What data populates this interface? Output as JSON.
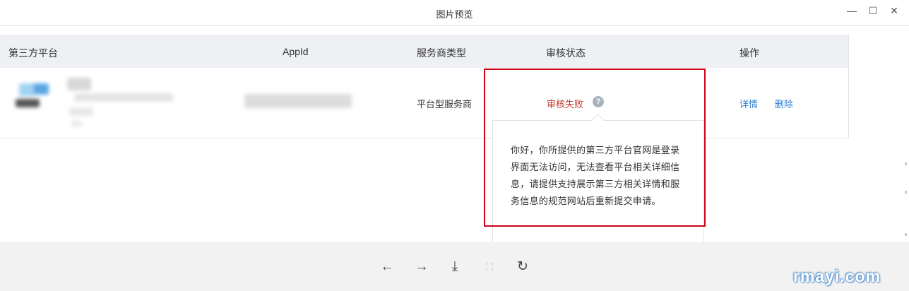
{
  "window": {
    "title": "图片预览",
    "controls": {
      "minimize": "—",
      "maximize": "☐",
      "close": "✕"
    }
  },
  "table": {
    "headers": [
      "第三方平台",
      "AppId",
      "服务商类型",
      "审核状态",
      "操作"
    ],
    "rows": [
      {
        "type": "平台型服务商",
        "status": "审核失败",
        "help_icon": "?",
        "actions": {
          "details": "详情",
          "delete": "删除"
        }
      }
    ]
  },
  "tooltip": {
    "text": "你好，你所提供的第三方平台官网是登录界面无法访问，无法查看平台相关详细信息，请提供支持展示第三方相关详情和服务信息的规范网站后重新提交申请。"
  },
  "toolbar": {
    "prev": "←",
    "next": "→",
    "download": "⤓",
    "fit": "⛶",
    "rotate": "↻"
  },
  "watermark": "rmayi.com",
  "colors": {
    "status_fail": "#c0392b",
    "link": "#2d7fd3",
    "highlight_border": "#d0021b",
    "header_bg": "#eef0f3"
  }
}
